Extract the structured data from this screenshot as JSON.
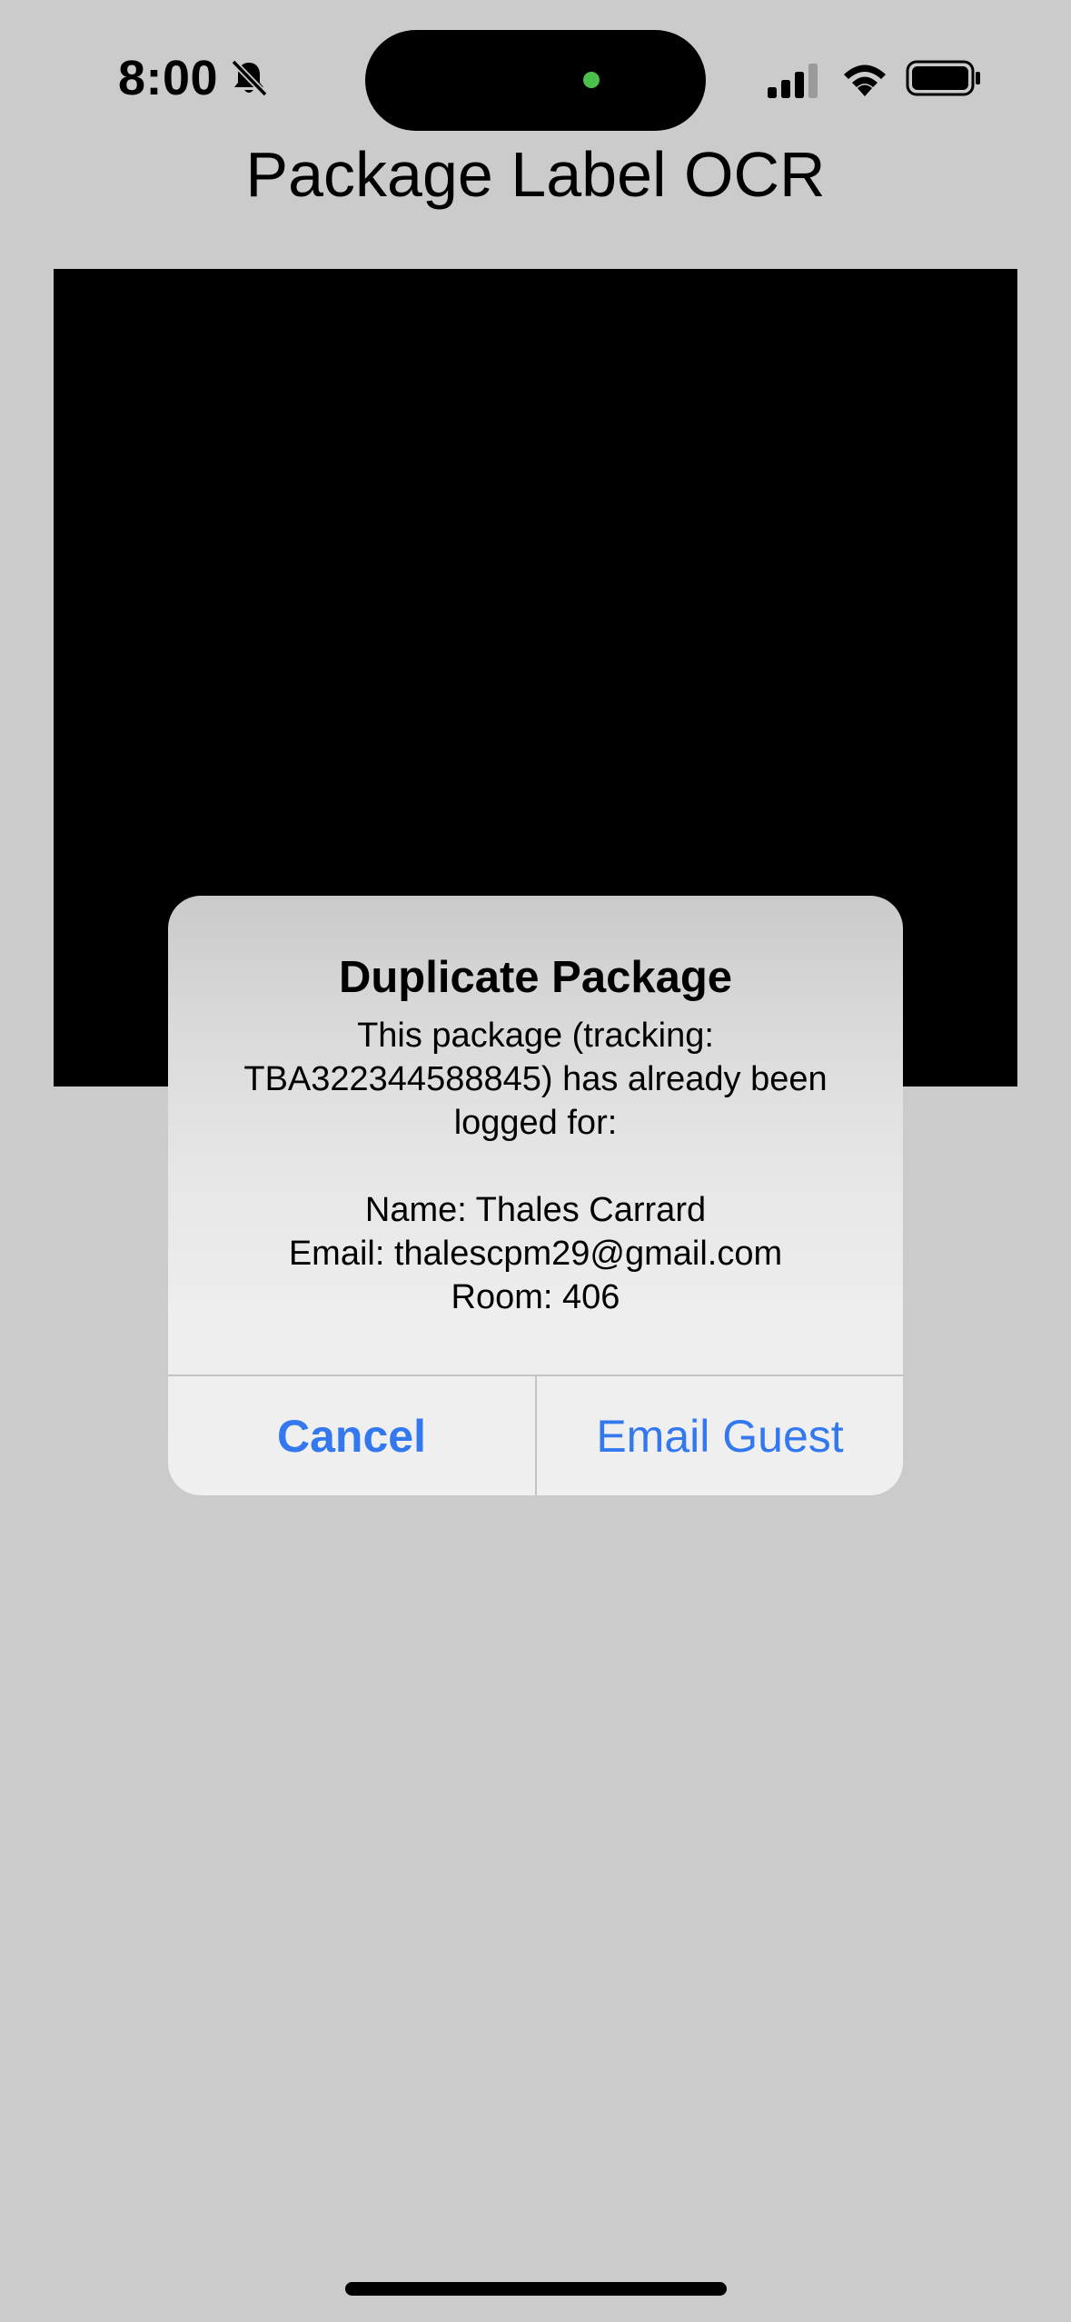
{
  "status_bar": {
    "time": "8:00",
    "icons": [
      "bell-slash-icon",
      "cellular-signal-icon",
      "wifi-icon",
      "battery-icon"
    ]
  },
  "page": {
    "title": "Package Label OCR"
  },
  "alert": {
    "title": "Duplicate Package",
    "message_lines": [
      "This package (tracking:",
      "TBA322344588845) has already been",
      "logged for:",
      "",
      "Name: Thales Carrard",
      "Email: thalescpm29@gmail.com",
      "Room: 406"
    ],
    "cancel_label": "Cancel",
    "email_label": "Email Guest"
  },
  "colors": {
    "background": "#cbcbcb",
    "accent": "#3478f0",
    "camera_preview": "#000000",
    "island_indicator": "#4cc04c"
  }
}
